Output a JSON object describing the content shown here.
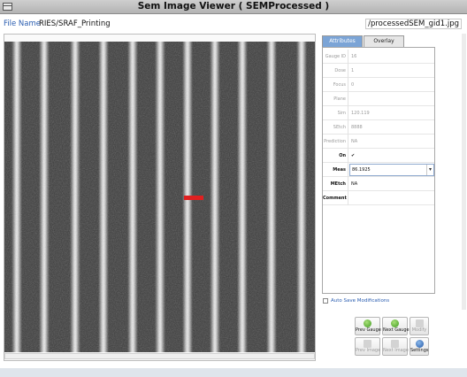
{
  "window": {
    "title": "Sem Image Viewer ( SEMProcessed )"
  },
  "file": {
    "label": "File Name",
    "path_left": "RIES/SRAF_Printing",
    "path_right": "/processedSEM_gid1.jpg"
  },
  "tabs": [
    {
      "label": "Attributes",
      "active": true
    },
    {
      "label": "Overlay Layout",
      "active": false
    }
  ],
  "attributes": [
    {
      "key": "Gauge ID",
      "value": "16"
    },
    {
      "key": "Dose",
      "value": "1"
    },
    {
      "key": "Focus",
      "value": "0"
    },
    {
      "key": "Plane",
      "value": ""
    },
    {
      "key": "Sim",
      "value": "120.119"
    },
    {
      "key": "SEtch",
      "value": "8888"
    },
    {
      "key": "Prediction",
      "value": "NA"
    },
    {
      "key": "On",
      "value": "✔"
    },
    {
      "key": "Meas",
      "value": "86.1925"
    },
    {
      "key": "MEtch",
      "value": "NA"
    },
    {
      "key": "Comment",
      "value": ""
    }
  ],
  "autosave_label": "Auto Save Modifications",
  "buttons": {
    "prev_gauge": "Prev Gauge",
    "next_gauge": "Next Gauge",
    "modify": "Modify",
    "prev_image": "Prev Image",
    "next_image": "Next Image",
    "settings": "Settings"
  },
  "colors": {
    "accent": "#2a5db0",
    "tab_active": "#7ba4d6",
    "marker": "#e02020"
  }
}
